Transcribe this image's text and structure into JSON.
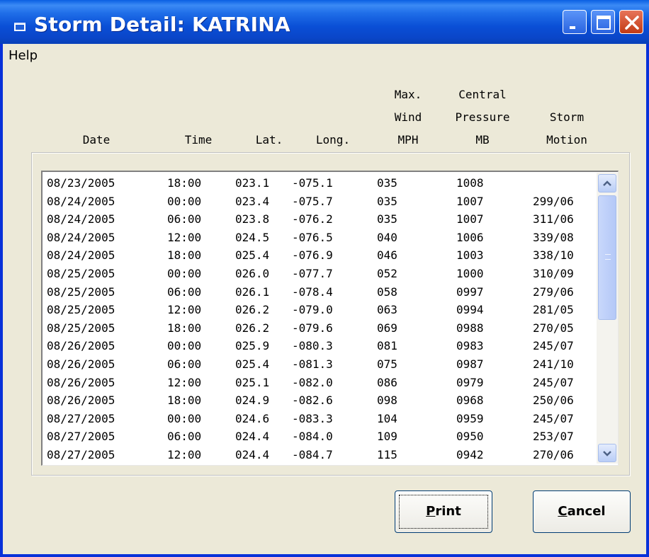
{
  "window": {
    "title": "Storm Detail: KATRINA"
  },
  "menu": {
    "help": "Help"
  },
  "headers": {
    "date": "Date",
    "time": "Time",
    "lat": "Lat.",
    "long": "Long.",
    "wind_line1": "Max.",
    "wind_line2": "Wind",
    "wind_line3": "MPH",
    "pressure_line1": "Central",
    "pressure_line2": "Pressure",
    "pressure_line3": "MB",
    "motion_line1": "Storm",
    "motion_line2": "Motion"
  },
  "rows": [
    [
      "08/23/2005",
      "18:00",
      "023.1",
      "-075.1",
      "035",
      "1008",
      ""
    ],
    [
      "08/24/2005",
      "00:00",
      "023.4",
      "-075.7",
      "035",
      "1007",
      "299/06"
    ],
    [
      "08/24/2005",
      "06:00",
      "023.8",
      "-076.2",
      "035",
      "1007",
      "311/06"
    ],
    [
      "08/24/2005",
      "12:00",
      "024.5",
      "-076.5",
      "040",
      "1006",
      "339/08"
    ],
    [
      "08/24/2005",
      "18:00",
      "025.4",
      "-076.9",
      "046",
      "1003",
      "338/10"
    ],
    [
      "08/25/2005",
      "00:00",
      "026.0",
      "-077.7",
      "052",
      "1000",
      "310/09"
    ],
    [
      "08/25/2005",
      "06:00",
      "026.1",
      "-078.4",
      "058",
      "0997",
      "279/06"
    ],
    [
      "08/25/2005",
      "12:00",
      "026.2",
      "-079.0",
      "063",
      "0994",
      "281/05"
    ],
    [
      "08/25/2005",
      "18:00",
      "026.2",
      "-079.6",
      "069",
      "0988",
      "270/05"
    ],
    [
      "08/26/2005",
      "00:00",
      "025.9",
      "-080.3",
      "081",
      "0983",
      "245/07"
    ],
    [
      "08/26/2005",
      "06:00",
      "025.4",
      "-081.3",
      "075",
      "0987",
      "241/10"
    ],
    [
      "08/26/2005",
      "12:00",
      "025.1",
      "-082.0",
      "086",
      "0979",
      "245/07"
    ],
    [
      "08/26/2005",
      "18:00",
      "024.9",
      "-082.6",
      "098",
      "0968",
      "250/06"
    ],
    [
      "08/27/2005",
      "00:00",
      "024.6",
      "-083.3",
      "104",
      "0959",
      "245/07"
    ],
    [
      "08/27/2005",
      "06:00",
      "024.4",
      "-084.0",
      "109",
      "0950",
      "253/07"
    ],
    [
      "08/27/2005",
      "12:00",
      "024.4",
      "-084.7",
      "115",
      "0942",
      "270/06"
    ]
  ],
  "buttons": {
    "print_mnemonic": "P",
    "print_rest": "rint",
    "cancel_mnemonic": "C",
    "cancel_rest": "ancel"
  },
  "colors": {
    "titlebar": "#0a4fd6",
    "window_bg": "#ece9d8",
    "close_button": "#c23a14"
  }
}
